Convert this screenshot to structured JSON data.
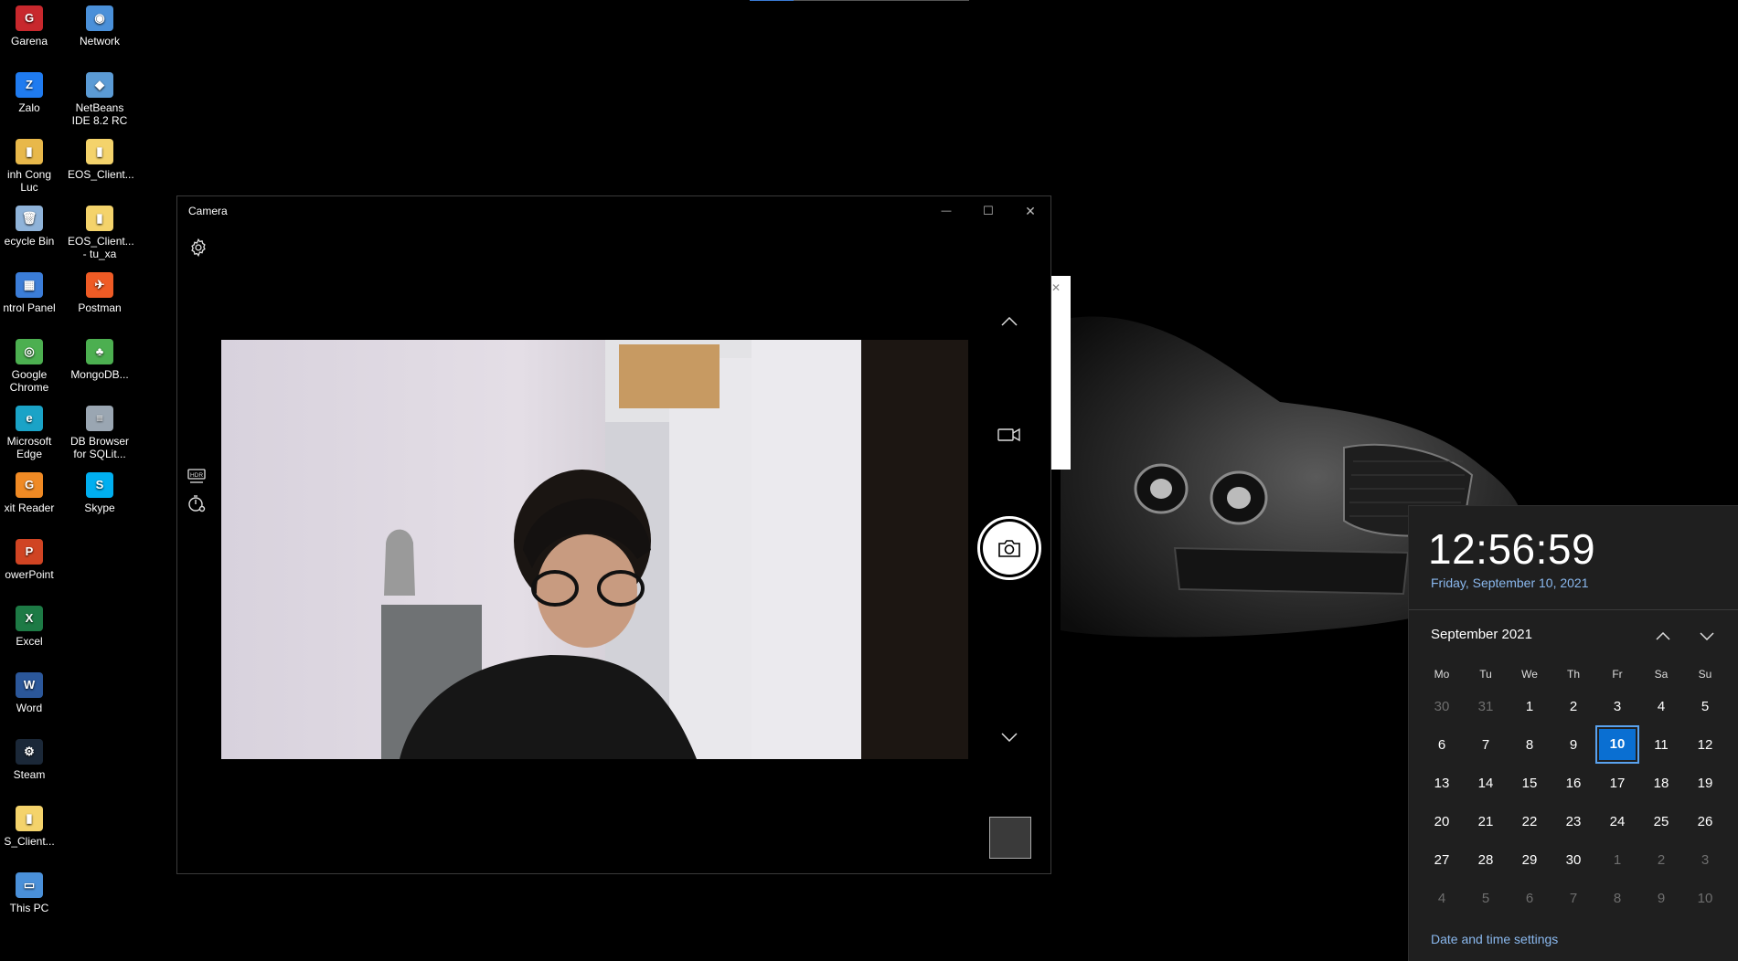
{
  "desktop": {
    "icons": [
      {
        "label": "Garena",
        "color": "#c8282d",
        "glyph": "G"
      },
      {
        "label": "Network",
        "color": "#4a90d9",
        "glyph": "◉"
      },
      {
        "label": "Zalo",
        "color": "#1f7bf0",
        "glyph": "Z"
      },
      {
        "label": "NetBeans IDE 8.2 RC",
        "color": "#5b9bd5",
        "glyph": "◆"
      },
      {
        "label": "inh Cong Luc",
        "color": "#e8b84a",
        "glyph": "▮"
      },
      {
        "label": "EOS_Client...",
        "color": "#f4d36b",
        "glyph": "▮"
      },
      {
        "label": "ecycle Bin",
        "color": "#8fb3d9",
        "glyph": "🗑"
      },
      {
        "label": "EOS_Client... - tu_xa",
        "color": "#f4d36b",
        "glyph": "▮"
      },
      {
        "label": "ntrol Panel",
        "color": "#3b7dd8",
        "glyph": "▦"
      },
      {
        "label": "Postman",
        "color": "#ef5b25",
        "glyph": "✈"
      },
      {
        "label": "Google Chrome",
        "color": "#4caf50",
        "glyph": "◎"
      },
      {
        "label": "MongoDB...",
        "color": "#4caf50",
        "glyph": "♣"
      },
      {
        "label": "Microsoft Edge",
        "color": "#1aa3c7",
        "glyph": "e"
      },
      {
        "label": "DB Browser for SQLit...",
        "color": "#9aa6b2",
        "glyph": "≡"
      },
      {
        "label": "xit Reader",
        "color": "#f08a24",
        "glyph": "G"
      },
      {
        "label": "Skype",
        "color": "#00aff0",
        "glyph": "S"
      },
      {
        "label": "owerPoint",
        "color": "#d04423",
        "glyph": "P"
      },
      {
        "label": "Excel",
        "color": "#1d7a45",
        "glyph": "X"
      },
      {
        "label": "Word",
        "color": "#2b579a",
        "glyph": "W"
      },
      {
        "label": "Steam",
        "color": "#1b2838",
        "glyph": "⚙"
      },
      {
        "label": "S_Client...",
        "color": "#f4d36b",
        "glyph": "▮"
      },
      {
        "label": "This PC",
        "color": "#4a90d9",
        "glyph": "▭"
      }
    ]
  },
  "camera": {
    "title": "Camera",
    "window_controls": {
      "minimize": "—",
      "maximize": "☐",
      "close": "✕"
    },
    "icons": {
      "settings": "settings-gear-icon",
      "hdr": "hdr-icon",
      "timer": "timer-icon",
      "up": "chevron-up-icon",
      "video": "video-mode-icon",
      "photo": "camera-shutter-icon",
      "down": "chevron-down-icon"
    }
  },
  "clock_flyout": {
    "time": "12:56:59",
    "date": "Friday, September 10, 2021",
    "month": "September 2021",
    "weekdays": [
      "Mo",
      "Tu",
      "We",
      "Th",
      "Fr",
      "Sa",
      "Su"
    ],
    "weeks": [
      [
        {
          "d": "30",
          "dim": true
        },
        {
          "d": "31",
          "dim": true
        },
        {
          "d": "1"
        },
        {
          "d": "2"
        },
        {
          "d": "3"
        },
        {
          "d": "4"
        },
        {
          "d": "5"
        }
      ],
      [
        {
          "d": "6"
        },
        {
          "d": "7"
        },
        {
          "d": "8"
        },
        {
          "d": "9"
        },
        {
          "d": "10",
          "today": true
        },
        {
          "d": "11"
        },
        {
          "d": "12"
        }
      ],
      [
        {
          "d": "13"
        },
        {
          "d": "14"
        },
        {
          "d": "15"
        },
        {
          "d": "16"
        },
        {
          "d": "17"
        },
        {
          "d": "18"
        },
        {
          "d": "19"
        }
      ],
      [
        {
          "d": "20"
        },
        {
          "d": "21"
        },
        {
          "d": "22"
        },
        {
          "d": "23"
        },
        {
          "d": "24"
        },
        {
          "d": "25"
        },
        {
          "d": "26"
        }
      ],
      [
        {
          "d": "27"
        },
        {
          "d": "28"
        },
        {
          "d": "29"
        },
        {
          "d": "30"
        },
        {
          "d": "1",
          "dim": true
        },
        {
          "d": "2",
          "dim": true
        },
        {
          "d": "3",
          "dim": true
        }
      ],
      [
        {
          "d": "4",
          "dim": true
        },
        {
          "d": "5",
          "dim": true
        },
        {
          "d": "6",
          "dim": true
        },
        {
          "d": "7",
          "dim": true
        },
        {
          "d": "8",
          "dim": true
        },
        {
          "d": "9",
          "dim": true
        },
        {
          "d": "10",
          "dim": true
        }
      ]
    ],
    "settings_link": "Date and time settings",
    "accent": "#0a6fd2"
  }
}
